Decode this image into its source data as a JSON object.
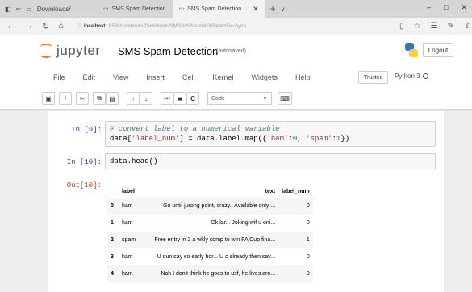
{
  "browser": {
    "tabs": [
      {
        "label": "Downloads/"
      },
      {
        "label": "SMS Spam Detection"
      },
      {
        "label": "SMS Spam Detection",
        "active": true
      }
    ],
    "url_host": "localhost",
    "url_path": ":8888/notebooks/Downloads/SMS%20Spam%20Detection.ipynb",
    "window_controls": [
      "–",
      "□",
      "✕"
    ]
  },
  "jupyter": {
    "brand": "jupyter",
    "notebook_title": "SMS Spam Detection",
    "save_status": "(autosaved)",
    "logout_label": "Logout",
    "menu": [
      "File",
      "Edit",
      "View",
      "Insert",
      "Cell",
      "Kernel",
      "Widgets",
      "Help"
    ],
    "trusted_label": "Trusted",
    "kernel_label": "Python 3",
    "cell_type": "Code"
  },
  "cells": {
    "cell9": {
      "prompt": "In [9]:",
      "comment": "# convert label to a numerical variable",
      "code_a": "data[",
      "str_a": "'label_num'",
      "code_b": "] = data.label.map({",
      "str_b": "'ham'",
      "code_c": ":",
      "num_a": "0",
      "code_d": ", ",
      "str_c": "'spam'",
      "code_e": ":",
      "num_b": "1",
      "code_f": "})"
    },
    "cell10": {
      "prompt": "In [10]:",
      "code": "data.head()",
      "out_prompt": "Out[10]:"
    }
  },
  "dataframe": {
    "columns": [
      "",
      "label",
      "text",
      "label_num"
    ],
    "rows": [
      {
        "index": "0",
        "label": "ham",
        "text": "Go until jurong point, crazy.. Available only ...",
        "label_num": "0"
      },
      {
        "index": "1",
        "label": "ham",
        "text": "Ok lar... Joking wif u oni...",
        "label_num": "0"
      },
      {
        "index": "2",
        "label": "spam",
        "text": "Free entry in 2 a wkly comp to win FA Cup fina...",
        "label_num": "1"
      },
      {
        "index": "3",
        "label": "ham",
        "text": "U dun say so early hor... U c already then say...",
        "label_num": "0"
      },
      {
        "index": "4",
        "label": "ham",
        "text": "Nah I don't think he goes to usf, he lives aro...",
        "label_num": "0"
      }
    ]
  }
}
